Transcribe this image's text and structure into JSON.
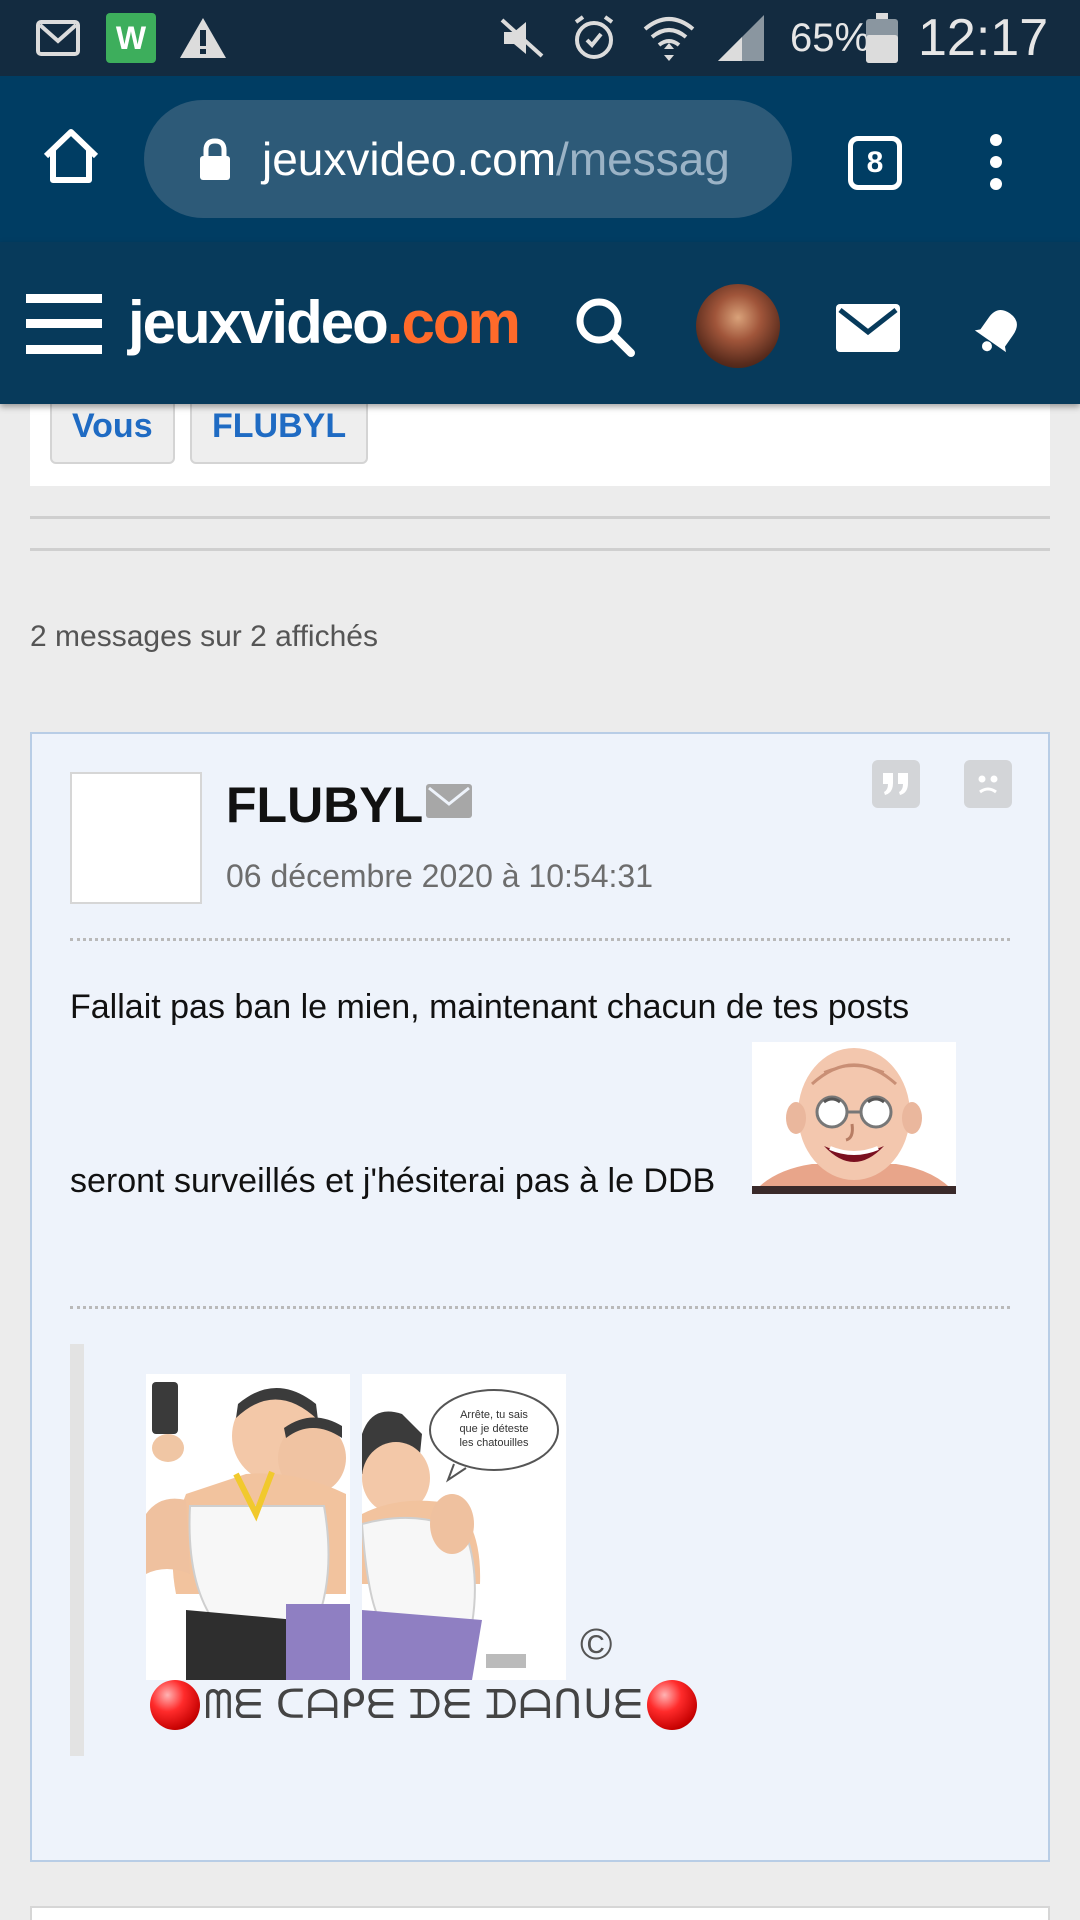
{
  "status_bar": {
    "battery": "65%",
    "time": "12:17"
  },
  "browser": {
    "url_host": "jeuxvideo.com",
    "url_path": "/messag",
    "tab_count": "8"
  },
  "site": {
    "logo_part1": "jeuxvideo",
    "logo_part2": ".com",
    "logo_colors": {
      "main": "#ffffff",
      "accent": "#ff6a2a"
    }
  },
  "filters": {
    "chips": [
      "Vous",
      "FLUBYL"
    ]
  },
  "messages_count": "2 messages sur 2 affichés",
  "post": {
    "author": "FLUBYL",
    "date": "06 décembre 2020 à 10:54:31",
    "text_line1": "Fallait pas ban le mien, maintenant chacun de tes posts",
    "text_line2": "seront surveillés et j'hésiterai pas à le DDB",
    "signature": {
      "copyright": "©",
      "text": "ᗰᗴ ᑕᗩᑭᗴ ᗪᗴ ᗪᗩᑎᑌᗴ",
      "speech_bubble": "Arrête, tu sais que je déteste les chatouilles"
    }
  }
}
